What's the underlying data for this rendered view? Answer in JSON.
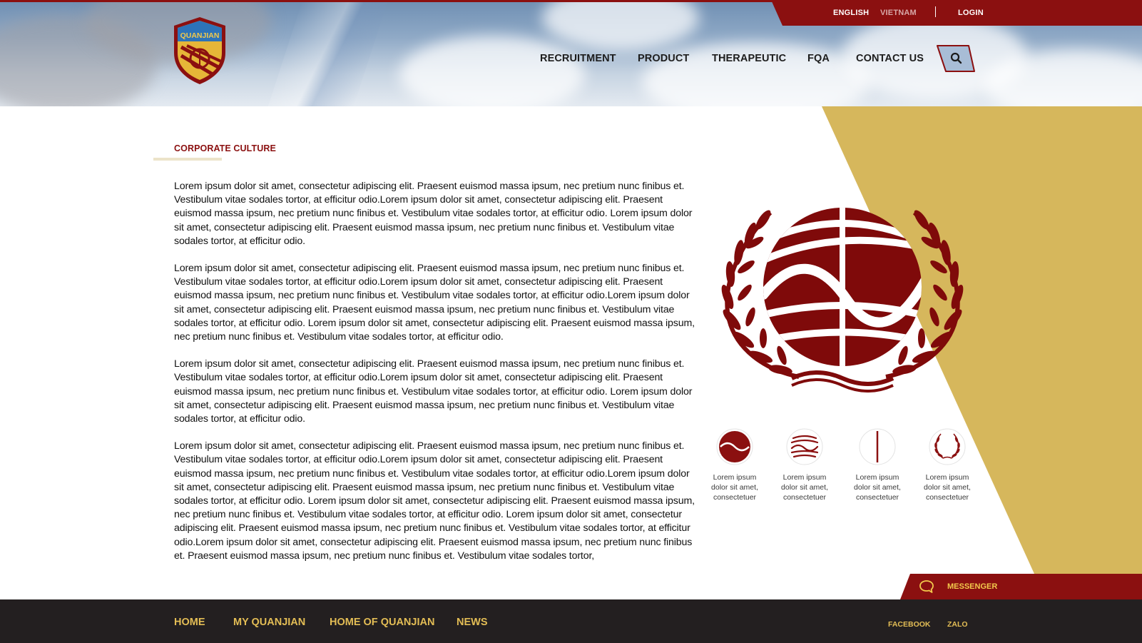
{
  "brand": {
    "logo_text": "QUANJIAN"
  },
  "topbar": {
    "lang_english": "ENGLISH",
    "lang_vietnam": "VIETNAM",
    "login": "LOGIN"
  },
  "nav": {
    "items": [
      "RECRUITMENT",
      "PRODUCT",
      "THERAPEUTIC",
      "FQA",
      "CONTACT US"
    ]
  },
  "search": {
    "icon": "search-icon"
  },
  "section": {
    "title": "CORPORATE CULTURE",
    "paragraphs": [
      "Lorem ipsum dolor sit amet, consectetur adipiscing elit. Praesent euismod massa ipsum, nec pretium nunc finibus et. Vestibulum vitae sodales tortor, at efficitur odio.Lorem ipsum dolor sit amet, consectetur adipiscing elit. Praesent euismod massa ipsum, nec pretium nunc finibus et. Vestibulum vitae sodales tortor, at efficitur odio. Lorem ipsum dolor sit amet, consectetur adipiscing elit. Praesent euismod massa ipsum, nec pretium nunc finibus et. Vestibulum vitae sodales tortor, at efficitur odio.",
      "Lorem ipsum dolor sit amet, consectetur adipiscing elit. Praesent euismod massa ipsum, nec pretium nunc finibus et. Vestibulum vitae sodales tortor, at efficitur odio.Lorem ipsum dolor sit amet, consectetur adipiscing elit. Praesent euismod massa ipsum, nec pretium nunc finibus et. Vestibulum vitae sodales tortor, at efficitur odio.Lorem ipsum dolor sit amet, consectetur adipiscing elit. Praesent euismod massa ipsum, nec pretium nunc finibus et. Vestibulum vitae sodales tortor, at efficitur odio. Lorem ipsum dolor sit amet, consectetur adipiscing elit. Praesent euismod massa ipsum, nec pretium nunc finibus et. Vestibulum vitae sodales tortor, at efficitur odio.",
      "Lorem ipsum dolor sit amet, consectetur adipiscing elit. Praesent euismod massa ipsum, nec pretium nunc finibus et. Vestibulum vitae sodales tortor, at efficitur odio.Lorem ipsum dolor sit amet, consectetur adipiscing elit. Praesent euismod massa ipsum, nec pretium nunc finibus et. Vestibulum vitae sodales tortor, at efficitur odio. Lorem ipsum dolor sit amet, consectetur adipiscing elit. Praesent euismod massa ipsum, nec pretium nunc finibus et. Vestibulum vitae sodales tortor, at efficitur odio.",
      "Lorem ipsum dolor sit amet, consectetur adipiscing elit. Praesent euismod massa ipsum, nec pretium nunc finibus et. Vestibulum vitae sodales tortor, at efficitur odio.Lorem ipsum dolor sit amet, consectetur adipiscing elit. Praesent euismod massa ipsum, nec pretium nunc finibus et. Vestibulum vitae sodales tortor, at efficitur odio.Lorem ipsum dolor sit amet, consectetur adipiscing elit. Praesent euismod massa ipsum, nec pretium nunc finibus et. Vestibulum vitae sodales tortor, at efficitur odio. Lorem ipsum dolor sit amet, consectetur adipiscing elit. Praesent euismod massa ipsum, nec pretium nunc finibus et. Vestibulum vitae sodales tortor, at efficitur odio. Lorem ipsum dolor sit amet, consectetur adipiscing elit. Praesent euismod massa ipsum, nec pretium nunc finibus et. Vestibulum vitae sodales tortor, at efficitur odio.Lorem ipsum dolor sit amet, consectetur adipiscing elit. Praesent euismod massa ipsum, nec pretium nunc finibus et. Praesent euismod massa ipsum, nec pretium nunc finibus et. Vestibulum vitae sodales tortor,"
    ]
  },
  "features": [
    {
      "icon": "globe-icon",
      "caption": "Lorem ipsum dolor sit amet, consectetuer"
    },
    {
      "icon": "waves-icon",
      "caption": "Lorem ipsum dolor sit amet, consectetuer"
    },
    {
      "icon": "vertical-line-icon",
      "caption": "Lorem ipsum dolor sit amet, consectetuer"
    },
    {
      "icon": "laurel-icon",
      "caption": "Lorem ipsum dolor sit amet, consectetuer"
    }
  ],
  "messenger": {
    "label": "MESSENGER",
    "icon": "chat-bubble-icon"
  },
  "footer": {
    "links": [
      "HOME",
      "MY QUANJIAN",
      "HOME OF QUANJIAN",
      "NEWS"
    ],
    "social": [
      "FACEBOOK",
      "ZALO"
    ]
  },
  "colors": {
    "brand_red": "#8b1010",
    "gold": "#d6b75c",
    "footer_bg": "#231f20",
    "footer_text": "#e3bd55"
  }
}
